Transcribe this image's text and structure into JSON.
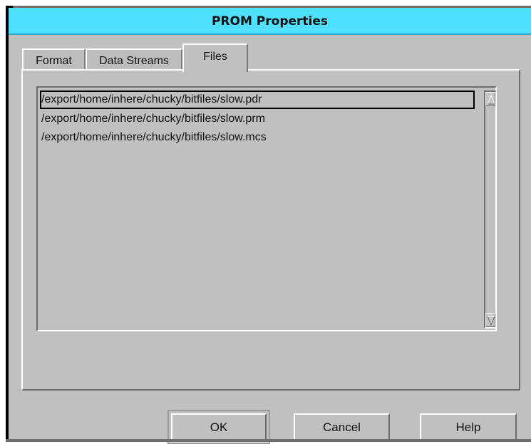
{
  "window": {
    "title": "PROM Properties"
  },
  "tabs": [
    {
      "label": "Format",
      "active": false
    },
    {
      "label": "Data Streams",
      "active": false
    },
    {
      "label": "Files",
      "active": true
    }
  ],
  "files": {
    "items": [
      {
        "path": "/export/home/inhere/chucky/bitfiles/slow.pdr",
        "selected": true
      },
      {
        "path": "/export/home/inhere/chucky/bitfiles/slow.prm",
        "selected": false
      },
      {
        "path": "/export/home/inhere/chucky/bitfiles/slow.mcs",
        "selected": false
      }
    ]
  },
  "buttons": {
    "ok": "OK",
    "cancel": "Cancel",
    "help": "Help"
  },
  "icons": {
    "scroll_up": "arrow-up-icon",
    "scroll_down": "arrow-down-icon"
  },
  "colors": {
    "titlebar": "#4fe0ff",
    "background": "#c0c0c0"
  }
}
